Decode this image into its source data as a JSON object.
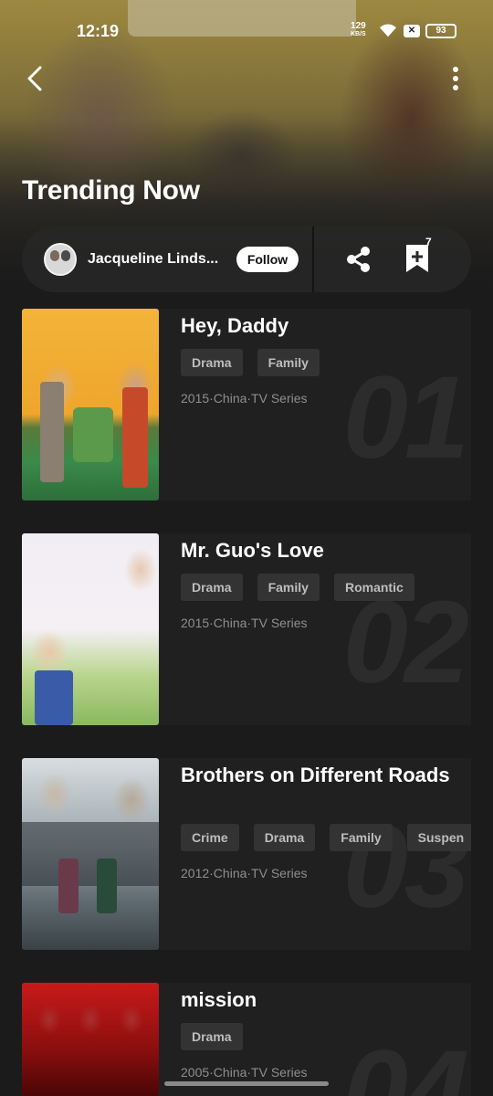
{
  "status_bar": {
    "time": "12:19",
    "net_speed_value": "129",
    "net_speed_unit": "KB/S",
    "battery": "93",
    "wifi_icon": "wifi-icon"
  },
  "header": {
    "back_icon": "chevron-left-icon",
    "more_icon": "more-vertical-icon",
    "title": "Trending Now"
  },
  "author": {
    "name": "Jacqueline Linds...",
    "follow_label": "Follow"
  },
  "actions": {
    "share_icon": "share-icon",
    "bookmark_icon": "bookmark-plus-icon",
    "bookmark_count": "7"
  },
  "items": [
    {
      "rank": "01",
      "title": "Hey, Daddy",
      "tags": [
        "Drama",
        "Family"
      ],
      "meta": "2015·China·TV Series"
    },
    {
      "rank": "02",
      "title": "Mr. Guo's Love",
      "tags": [
        "Drama",
        "Family",
        "Romantic"
      ],
      "meta": "2015·China·TV Series"
    },
    {
      "rank": "03",
      "title": "Brothers on Different Roads",
      "tags": [
        "Crime",
        "Drama",
        "Family",
        "Suspen"
      ],
      "meta": "2012·China·TV Series"
    },
    {
      "rank": "04",
      "title": "mission",
      "tags": [
        "Drama"
      ],
      "meta": "2005·China·TV Series"
    }
  ],
  "colors": {
    "background": "#1b1b1b",
    "card": "#202020",
    "tag_bg": "#333333",
    "tag_text": "#bdbdbd",
    "meta_text": "#8e8e8e"
  }
}
